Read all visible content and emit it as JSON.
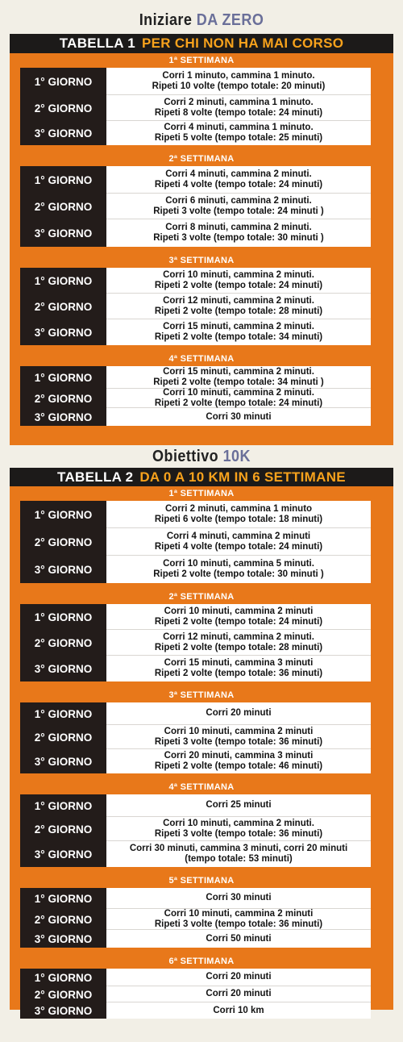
{
  "heading1": {
    "part1": "Iniziare",
    "part2": "DA ZERO"
  },
  "table1": {
    "label": "TABELLA 1",
    "subtitle": "PER CHI NON HA MAI CORSO",
    "weeks": [
      {
        "title": "1ª SETTIMANA",
        "days": [
          {
            "day": "1° GIORNO",
            "lines": [
              "Corri 1 minuto, cammina 1 minuto.",
              "Ripeti 10 volte (tempo totale: 20 minuti)"
            ]
          },
          {
            "day": "2° GIORNO",
            "lines": [
              "Corri 2 minuti, cammina 1 minuto.",
              "Ripeti 8 volte (tempo totale: 24 minuti)"
            ]
          },
          {
            "day": "3° GIORNO",
            "lines": [
              "Corri 4 minuti, cammina 1 minuto.",
              "Ripeti 5 volte (tempo totale: 25 minuti)"
            ]
          }
        ]
      },
      {
        "title": "2ª SETTIMANA",
        "days": [
          {
            "day": "1° GIORNO",
            "lines": [
              "Corri 4 minuti, cammina 2 minuti.",
              "Ripeti 4 volte (tempo totale: 24 minuti)"
            ]
          },
          {
            "day": "2° GIORNO",
            "lines": [
              "Corri 6 minuti, cammina 2 minuti.",
              "Ripeti 3 volte (tempo totale: 24 minuti )"
            ]
          },
          {
            "day": "3° GIORNO",
            "lines": [
              "Corri 8 minuti, cammina 2 minuti.",
              "Ripeti 3 volte (tempo totale: 30 minuti )"
            ]
          }
        ]
      },
      {
        "title": "3ª SETTIMANA",
        "days": [
          {
            "day": "1° GIORNO",
            "lines": [
              "Corri 10 minuti, cammina 2 minuti.",
              "Ripeti 2 volte (tempo totale: 24 minuti)"
            ]
          },
          {
            "day": "2° GIORNO",
            "lines": [
              "Corri 12 minuti, cammina 2 minuti.",
              "Ripeti 2 volte (tempo totale: 28 minuti)"
            ]
          },
          {
            "day": "3° GIORNO",
            "lines": [
              "Corri 15 minuti, cammina 2 minuti.",
              "Ripeti 2 volte (tempo totale: 34 minuti)"
            ]
          }
        ]
      },
      {
        "title": "4ª SETTIMANA",
        "days": [
          {
            "day": "1° GIORNO",
            "lines": [
              "Corri 15 minuti, cammina 2 minuti.",
              "Ripeti 2 volte (tempo totale: 34 minuti )"
            ]
          },
          {
            "day": "2° GIORNO",
            "lines": [
              "Corri 10 minuti, cammina 2 minuti.",
              "Ripeti 2 volte (tempo totale: 24 minuti)"
            ]
          },
          {
            "day": "3° GIORNO",
            "lines": [
              "Corri 30 minuti"
            ]
          }
        ]
      }
    ]
  },
  "heading2": {
    "part1": "Obiettivo",
    "part2": "10K"
  },
  "table2": {
    "label": "TABELLA 2",
    "subtitle": "DA 0 A 10 KM IN 6 SETTIMANE",
    "weeks": [
      {
        "title": "1ª SETTIMANA",
        "days": [
          {
            "day": "1° GIORNO",
            "lines": [
              "Corri 2 minuti, cammina 1 minuto",
              "Ripeti 6 volte (tempo totale: 18 minuti)"
            ]
          },
          {
            "day": "2° GIORNO",
            "lines": [
              "Corri 4 minuti, cammina 2 minuti",
              "Ripeti 4 volte (tempo totale: 24 minuti)"
            ]
          },
          {
            "day": "3° GIORNO",
            "lines": [
              "Corri 10 minuti, cammina 5 minuti.",
              "Ripeti 2 volte (tempo totale: 30 minuti )"
            ]
          }
        ]
      },
      {
        "title": "2ª SETTIMANA",
        "days": [
          {
            "day": "1° GIORNO",
            "lines": [
              "Corri 10 minuti, cammina 2 minuti",
              "Ripeti 2 volte (tempo totale: 24 minuti)"
            ]
          },
          {
            "day": "2° GIORNO",
            "lines": [
              "Corri 12 minuti, cammina 2 minuti.",
              "Ripeti 2 volte (tempo totale: 28 minuti)"
            ]
          },
          {
            "day": "3° GIORNO",
            "lines": [
              "Corri 15 minuti, cammina 3 minuti",
              "Ripeti 2 volte (tempo totale: 36 minuti)"
            ]
          }
        ]
      },
      {
        "title": "3ª SETTIMANA",
        "days": [
          {
            "day": "1° GIORNO",
            "lines": [
              "Corri 20 minuti"
            ]
          },
          {
            "day": "2° GIORNO",
            "lines": [
              "Corri 10 minuti, cammina 2 minuti",
              "Ripeti 3 volte (tempo totale: 36 minuti)"
            ]
          },
          {
            "day": "3° GIORNO",
            "lines": [
              "Corri 20 minuti, cammina 3 minuti",
              "Ripeti 2 volte (tempo totale: 46 minuti)"
            ]
          }
        ]
      },
      {
        "title": "4ª SETTIMANA",
        "days": [
          {
            "day": "1° GIORNO",
            "lines": [
              "Corri 25 minuti"
            ]
          },
          {
            "day": "2° GIORNO",
            "lines": [
              "Corri 10 minuti, cammina 2 minuti.",
              "Ripeti 3 volte (tempo totale: 36 minuti)"
            ]
          },
          {
            "day": "3° GIORNO",
            "lines": [
              "Corri 30 minuti, cammina 3 minuti, corri 20 minuti",
              "(tempo totale: 53 minuti)"
            ]
          }
        ]
      },
      {
        "title": "5ª SETTIMANA",
        "days": [
          {
            "day": "1° GIORNO",
            "lines": [
              "Corri 30 minuti"
            ]
          },
          {
            "day": "2° GIORNO",
            "lines": [
              "Corri 10 minuti, cammina 2 minuti",
              "Ripeti 3 volte (tempo totale: 36 minuti)"
            ]
          },
          {
            "day": "3° GIORNO",
            "lines": [
              "Corri 50 minuti"
            ]
          }
        ]
      },
      {
        "title": "6ª SETTIMANA",
        "days": [
          {
            "day": "1° GIORNO",
            "lines": [
              "Corri 20 minuti"
            ]
          },
          {
            "day": "2° GIORNO",
            "lines": [
              "Corri 20 minuti"
            ]
          },
          {
            "day": "3° GIORNO",
            "lines": [
              "Corri 10 km"
            ]
          }
        ]
      }
    ]
  }
}
